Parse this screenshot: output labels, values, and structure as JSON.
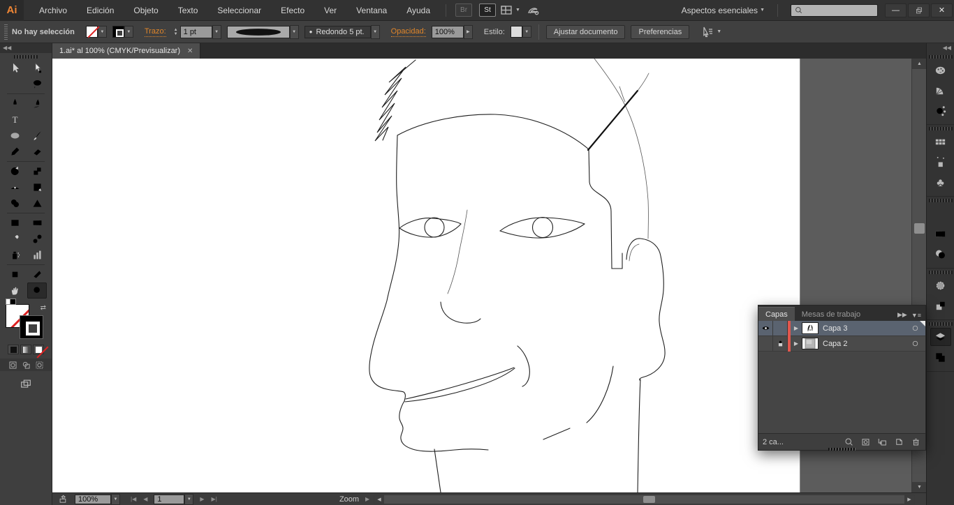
{
  "menu_bar": {
    "logo": "Ai",
    "items": [
      "Archivo",
      "Edición",
      "Objeto",
      "Texto",
      "Seleccionar",
      "Efecto",
      "Ver",
      "Ventana",
      "Ayuda"
    ],
    "bridge_button": "Br",
    "stock_button": "St",
    "workspace_label": "Aspectos esenciales",
    "search_value": "",
    "window_controls": [
      "minimize",
      "restore",
      "close"
    ]
  },
  "control_bar": {
    "selection_status": "No hay selección",
    "stroke_label": "Trazo:",
    "stroke_width_value": "1 pt",
    "brush_definition_label": "Redondo 5 pt.",
    "opacity_label": "Opacidad:",
    "opacity_value": "100%",
    "style_label": "Estilo:",
    "fit_document_button": "Ajustar documento",
    "preferences_button": "Preferencias"
  },
  "document_tab": {
    "title": "1.ai* al 100% (CMYK/Previsualizar)",
    "close_glyph": "✕"
  },
  "toolbar": {
    "tools": [
      "selection",
      "direct-selection",
      "magic-wand",
      "lasso",
      "pen",
      "curvature-pen",
      "type",
      "line-segment",
      "ellipse",
      "paintbrush",
      "pencil",
      "eraser",
      "rotate",
      "scale",
      "width-tool",
      "free-transform",
      "shape-builder",
      "perspective-grid",
      "mesh",
      "gradient",
      "eyedropper",
      "blend",
      "symbol-sprayer",
      "column-graph",
      "artboard",
      "slice",
      "hand",
      "zoom"
    ],
    "selected_tool": "zoom",
    "collapse_glyph": "◀◀"
  },
  "dock": {
    "collapse_glyph": "◀◀",
    "groups": [
      [
        "color",
        "color-guide",
        "color-themes"
      ],
      [
        "swatches",
        "brushes",
        "symbols"
      ],
      [
        "stroke",
        "gradient",
        "transparency"
      ],
      [
        "appearance",
        "graphic-styles"
      ],
      [
        "layers",
        "artboards"
      ]
    ],
    "selected": "layers"
  },
  "layers_panel": {
    "tabs": [
      "Capas",
      "Mesas de trabajo"
    ],
    "expand_glyph": "▶▶",
    "layers": [
      {
        "name": "Capa 3",
        "visible": true,
        "locked": false,
        "selected": true,
        "color": "#e2574e",
        "thumb": "face"
      },
      {
        "name": "Capa 2",
        "visible": false,
        "locked": true,
        "selected": false,
        "color": "#e2574e",
        "thumb": "image"
      }
    ],
    "status_text": "2 ca...",
    "buttons": [
      "locate-object",
      "make-clip-mask",
      "new-sublayer",
      "new-layer",
      "delete"
    ]
  },
  "status_bar": {
    "zoom_level": "100%",
    "artboard_number": "1",
    "tool_label": "Zoom",
    "nav": {
      "first": "|◀",
      "prev": "◀",
      "next": "▶",
      "last": "▶|"
    }
  },
  "glyphs": {
    "dropdown": "▼",
    "spin_up": "▲",
    "spin_down": "▼",
    "expand_row": "▶",
    "up": "▲",
    "down": "▼",
    "left": "◀",
    "right": "▶",
    "swap": "⇄",
    "panel_menu": "▼≡",
    "brush_dot": "●",
    "minimize": "—"
  },
  "colors": {
    "accent_orange": "#e0862a",
    "layer_color_bar": "#e2574e",
    "selected_row": "#5a6370",
    "canvas": "#ffffff",
    "pasteboard": "#5c5c5c",
    "ui_dark": "#323232"
  }
}
